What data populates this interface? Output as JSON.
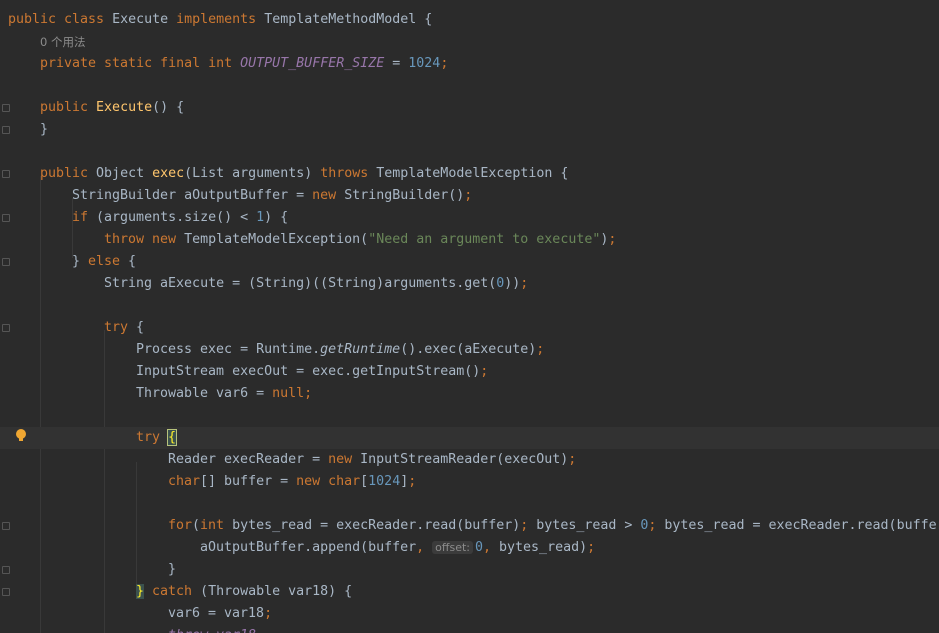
{
  "editor": {
    "lines": [
      [
        "public class Execute implements TemplateMethodModel {"
      ],
      [
        "0 个用法"
      ],
      [
        "private static final int OUTPUT_BUFFER_SIZE = 1024;"
      ],
      [
        ""
      ],
      [
        "public Execute() {"
      ],
      [
        "}"
      ],
      [
        ""
      ],
      [
        "public Object exec(List arguments) throws TemplateModelException {"
      ],
      [
        "StringBuilder aOutputBuffer = new StringBuilder();"
      ],
      [
        "if (arguments.size() < 1) {"
      ],
      [
        "throw new TemplateModelException(\"Need an argument to execute\");"
      ],
      [
        "} else {"
      ],
      [
        "String aExecute = (String)((String)arguments.get(0));"
      ],
      [
        ""
      ],
      [
        "try {"
      ],
      [
        "Process exec = Runtime.getRuntime().exec(aExecute);"
      ],
      [
        "InputStream execOut = exec.getInputStream();"
      ],
      [
        "Throwable var6 = null;"
      ],
      [
        ""
      ],
      [
        "try {"
      ],
      [
        "Reader execReader = new InputStreamReader(execOut);"
      ],
      [
        "char[] buffer = new char[1024];"
      ],
      [
        ""
      ],
      [
        "for(int bytes_read = execReader.read(buffer); bytes_read > 0; bytes_read = execReader.read(buffer"
      ],
      [
        "aOutputBuffer.append(buffer, offset: 0, bytes_read);"
      ],
      [
        "}"
      ],
      [
        "} catch (Throwable var18) {"
      ],
      [
        "var6 = var18;"
      ]
    ],
    "inlay_hint": "offset:",
    "usage_hint": "0 个用法",
    "accent_colors": {
      "keyword": "#cc7832",
      "function": "#ffc66d",
      "number": "#6897bb",
      "string": "#6a8759",
      "constant": "#9876aa",
      "text": "#a9b7c6",
      "background": "#2b2b2b"
    }
  }
}
